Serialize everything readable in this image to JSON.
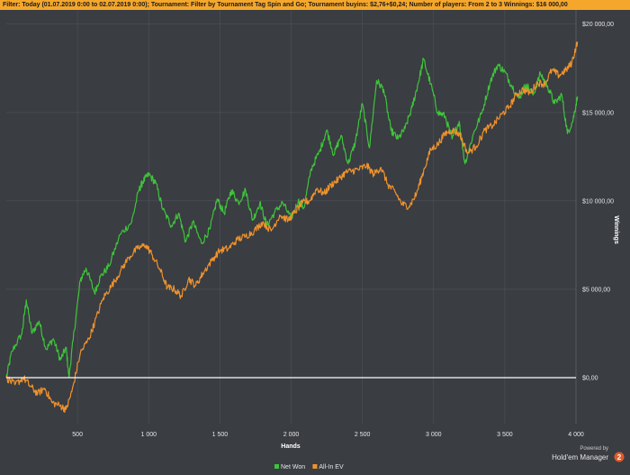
{
  "filter": {
    "label": "Filter:",
    "text": "Today (01.07.2019 0:00 to 02.07.2019 0:00); Tournament: Filter by Tournament Tag  Spin and Go; Tournament buyins: $2,76+$0,24; Number of players: From 2 to 3 Winnings: $16 000,00"
  },
  "footer": {
    "powered_by": "Powered by",
    "brand": "Hold'em Manager",
    "brand_version": "2"
  },
  "chart_data": {
    "type": "line",
    "title": "",
    "xlabel": "Hands",
    "ylabel": "Winnings",
    "xlim": [
      0,
      4000
    ],
    "ylim": [
      -2600,
      20800
    ],
    "x_ticks": [
      500,
      1000,
      1500,
      2000,
      2500,
      3000,
      3500,
      4000
    ],
    "x_tick_labels": [
      "500",
      "1 000",
      "1 500",
      "2 000",
      "2 500",
      "3 000",
      "3 500",
      "4 000"
    ],
    "y_ticks": [
      0,
      5000,
      10000,
      15000,
      20000
    ],
    "y_tick_labels": [
      "$0,00",
      "$5 000,00",
      "$10 000,00",
      "$15 000,00",
      "$20 000,00"
    ],
    "grid": true,
    "legend_position": "bottom-center",
    "series": [
      {
        "name": "Net Won",
        "color": "#3ec43a",
        "points": [
          [
            0,
            0
          ],
          [
            40,
            1500
          ],
          [
            110,
            2500
          ],
          [
            140,
            4400
          ],
          [
            180,
            2500
          ],
          [
            230,
            3200
          ],
          [
            280,
            1600
          ],
          [
            330,
            2200
          ],
          [
            380,
            1000
          ],
          [
            420,
            1700
          ],
          [
            440,
            0
          ],
          [
            470,
            2200
          ],
          [
            520,
            5500
          ],
          [
            560,
            6200
          ],
          [
            620,
            4800
          ],
          [
            660,
            5700
          ],
          [
            720,
            6300
          ],
          [
            800,
            8100
          ],
          [
            880,
            8800
          ],
          [
            930,
            10600
          ],
          [
            960,
            11100
          ],
          [
            1000,
            11500
          ],
          [
            1050,
            11000
          ],
          [
            1100,
            9500
          ],
          [
            1160,
            8600
          ],
          [
            1210,
            9300
          ],
          [
            1260,
            7700
          ],
          [
            1310,
            8800
          ],
          [
            1370,
            7600
          ],
          [
            1430,
            8400
          ],
          [
            1480,
            10100
          ],
          [
            1530,
            9300
          ],
          [
            1580,
            10600
          ],
          [
            1630,
            9900
          ],
          [
            1680,
            10600
          ],
          [
            1730,
            8900
          ],
          [
            1780,
            9900
          ],
          [
            1830,
            8600
          ],
          [
            1880,
            9300
          ],
          [
            1940,
            9900
          ],
          [
            2000,
            9000
          ],
          [
            2050,
            10000
          ],
          [
            2090,
            9600
          ],
          [
            2140,
            11800
          ],
          [
            2200,
            12800
          ],
          [
            2250,
            14000
          ],
          [
            2300,
            12600
          ],
          [
            2350,
            13700
          ],
          [
            2400,
            12100
          ],
          [
            2450,
            13300
          ],
          [
            2500,
            15500
          ],
          [
            2550,
            13000
          ],
          [
            2600,
            16800
          ],
          [
            2650,
            16300
          ],
          [
            2700,
            14000
          ],
          [
            2750,
            13500
          ],
          [
            2800,
            14100
          ],
          [
            2850,
            15300
          ],
          [
            2890,
            16600
          ],
          [
            2930,
            18000
          ],
          [
            2980,
            16600
          ],
          [
            3030,
            15000
          ],
          [
            3080,
            14800
          ],
          [
            3130,
            13500
          ],
          [
            3180,
            14500
          ],
          [
            3220,
            12100
          ],
          [
            3280,
            13800
          ],
          [
            3340,
            15000
          ],
          [
            3400,
            16800
          ],
          [
            3450,
            17700
          ],
          [
            3500,
            17300
          ],
          [
            3550,
            16500
          ],
          [
            3600,
            15800
          ],
          [
            3650,
            16600
          ],
          [
            3700,
            16000
          ],
          [
            3750,
            17200
          ],
          [
            3800,
            16500
          ],
          [
            3850,
            15500
          ],
          [
            3900,
            16000
          ],
          [
            3940,
            13800
          ],
          [
            3980,
            14600
          ],
          [
            4010,
            15900
          ]
        ]
      },
      {
        "name": "All-In EV",
        "color": "#f0922c",
        "points": [
          [
            0,
            0
          ],
          [
            60,
            -400
          ],
          [
            120,
            0
          ],
          [
            170,
            -500
          ],
          [
            220,
            -900
          ],
          [
            270,
            -600
          ],
          [
            320,
            -1400
          ],
          [
            380,
            -1600
          ],
          [
            420,
            -1800
          ],
          [
            460,
            -800
          ],
          [
            520,
            1400
          ],
          [
            580,
            2200
          ],
          [
            620,
            3100
          ],
          [
            680,
            4500
          ],
          [
            740,
            5200
          ],
          [
            800,
            6000
          ],
          [
            860,
            6800
          ],
          [
            920,
            7300
          ],
          [
            980,
            7500
          ],
          [
            1020,
            7000
          ],
          [
            1080,
            6100
          ],
          [
            1130,
            5100
          ],
          [
            1180,
            5000
          ],
          [
            1230,
            4600
          ],
          [
            1280,
            5600
          ],
          [
            1330,
            5200
          ],
          [
            1380,
            5900
          ],
          [
            1440,
            6600
          ],
          [
            1500,
            7200
          ],
          [
            1560,
            7300
          ],
          [
            1620,
            7800
          ],
          [
            1680,
            8000
          ],
          [
            1740,
            8300
          ],
          [
            1800,
            8800
          ],
          [
            1860,
            8300
          ],
          [
            1920,
            9200
          ],
          [
            1980,
            8900
          ],
          [
            2030,
            9400
          ],
          [
            2080,
            9900
          ],
          [
            2130,
            10000
          ],
          [
            2180,
            10700
          ],
          [
            2230,
            10400
          ],
          [
            2280,
            10900
          ],
          [
            2330,
            11200
          ],
          [
            2380,
            11600
          ],
          [
            2430,
            11700
          ],
          [
            2480,
            11800
          ],
          [
            2530,
            12000
          ],
          [
            2580,
            11500
          ],
          [
            2630,
            11900
          ],
          [
            2680,
            10900
          ],
          [
            2730,
            10500
          ],
          [
            2780,
            9800
          ],
          [
            2830,
            9700
          ],
          [
            2880,
            10400
          ],
          [
            2930,
            11700
          ],
          [
            2980,
            12900
          ],
          [
            3030,
            13200
          ],
          [
            3080,
            13800
          ],
          [
            3130,
            14000
          ],
          [
            3180,
            13800
          ],
          [
            3240,
            12700
          ],
          [
            3300,
            13100
          ],
          [
            3360,
            14000
          ],
          [
            3420,
            14300
          ],
          [
            3480,
            14900
          ],
          [
            3530,
            15300
          ],
          [
            3580,
            16000
          ],
          [
            3630,
            16300
          ],
          [
            3680,
            16100
          ],
          [
            3730,
            16700
          ],
          [
            3780,
            16600
          ],
          [
            3830,
            17400
          ],
          [
            3880,
            17100
          ],
          [
            3930,
            17400
          ],
          [
            3970,
            17800
          ],
          [
            4010,
            19000
          ]
        ]
      }
    ]
  }
}
